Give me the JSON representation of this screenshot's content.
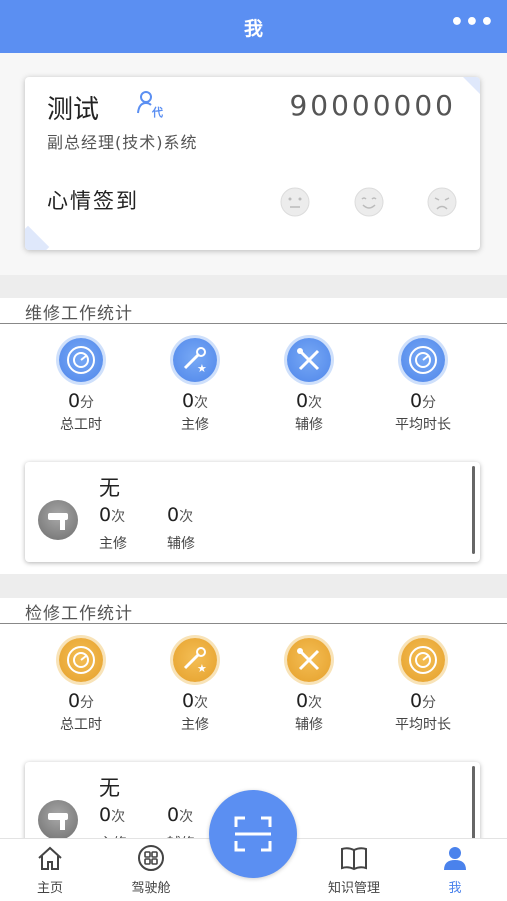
{
  "header": {
    "title": "我",
    "more_icon": "more-dots-icon"
  },
  "profile": {
    "name": "测试",
    "phone": "90000000",
    "role": "副总经理(技术)系统",
    "mood_label": "心情签到",
    "moods": [
      "neutral-face-icon",
      "smile-face-icon",
      "sad-face-icon"
    ]
  },
  "maintenance": {
    "title": "维修工作统计",
    "stats": [
      {
        "value": "0",
        "unit": "分",
        "label": "总工时",
        "icon": "timer-icon"
      },
      {
        "value": "0",
        "unit": "次",
        "label": "主修",
        "icon": "wrench-star-icon"
      },
      {
        "value": "0",
        "unit": "次",
        "label": "辅修",
        "icon": "tools-cross-icon"
      },
      {
        "value": "0",
        "unit": "分",
        "label": "平均时长",
        "icon": "timer-icon"
      }
    ],
    "worker": {
      "name": "无",
      "main_value": "0",
      "main_unit": "次",
      "main_label": "主修",
      "assist_value": "0",
      "assist_unit": "次",
      "assist_label": "辅修"
    }
  },
  "inspection": {
    "title": "检修工作统计",
    "stats": [
      {
        "value": "0",
        "unit": "分",
        "label": "总工时",
        "icon": "timer-icon"
      },
      {
        "value": "0",
        "unit": "次",
        "label": "主修",
        "icon": "wrench-star-icon"
      },
      {
        "value": "0",
        "unit": "次",
        "label": "辅修",
        "icon": "tools-cross-icon"
      },
      {
        "value": "0",
        "unit": "分",
        "label": "平均时长",
        "icon": "timer-icon"
      }
    ],
    "worker": {
      "name": "无",
      "main_value": "0",
      "main_unit": "次",
      "main_label": "主修",
      "assist_value": "0",
      "assist_unit": "次",
      "assist_label": "辅修"
    }
  },
  "tabs": [
    {
      "label": "主页",
      "icon": "home-icon",
      "active": false
    },
    {
      "label": "驾驶舱",
      "icon": "grid-circle-icon",
      "active": false
    },
    {
      "label": "知识管理",
      "icon": "book-icon",
      "active": false
    },
    {
      "label": "我",
      "icon": "user-icon",
      "active": true
    }
  ],
  "colors": {
    "primary": "#5b8ff2",
    "gold": "#e5a02b",
    "active_tab": "#4a82ec"
  }
}
